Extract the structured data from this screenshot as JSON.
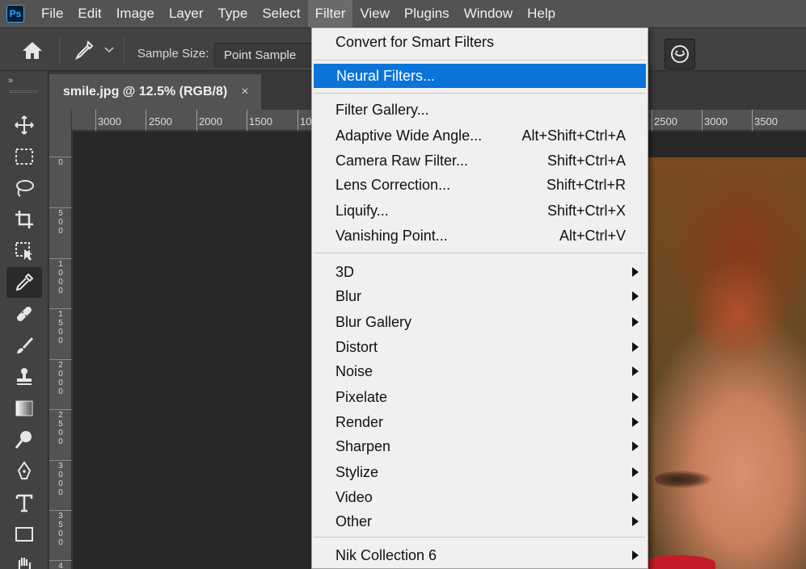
{
  "app": {
    "logo": "Ps"
  },
  "menubar": {
    "items": [
      "File",
      "Edit",
      "Image",
      "Layer",
      "Type",
      "Select",
      "Filter",
      "View",
      "Plugins",
      "Window",
      "Help"
    ],
    "active": "Filter"
  },
  "options": {
    "sample_size_label": "Sample Size:",
    "sample_size_value": "Point Sample"
  },
  "toolpanel": {
    "collapse": "››",
    "tools": [
      "move-icon",
      "marquee-icon",
      "lasso-icon",
      "crop-icon",
      "object-select-icon",
      "eyedropper-icon",
      "healing-icon",
      "brush-icon",
      "stamp-icon",
      "gradient-icon",
      "dodge-icon",
      "pen-icon",
      "type-icon",
      "rectangle-icon",
      "hand-icon"
    ],
    "active": "eyedropper-icon"
  },
  "document": {
    "tab_title": "smile.jpg @ 12.5% (RGB/8)",
    "close": "×"
  },
  "ruler_top": [
    "3000",
    "2500",
    "2000",
    "1500",
    "10",
    "2500",
    "3000",
    "3500"
  ],
  "ruler_left": [
    "0",
    "500",
    "1000",
    "1500",
    "2000",
    "2500",
    "3000",
    "3500",
    "4"
  ],
  "filter_menu": {
    "group1": [
      {
        "label": "Convert for Smart Filters"
      }
    ],
    "group2": [
      {
        "label": "Neural Filters...",
        "highlighted": true
      }
    ],
    "group3": [
      {
        "label": "Filter Gallery...",
        "shortcut": ""
      },
      {
        "label": "Adaptive Wide Angle...",
        "shortcut": "Alt+Shift+Ctrl+A"
      },
      {
        "label": "Camera Raw Filter...",
        "shortcut": "Shift+Ctrl+A"
      },
      {
        "label": "Lens Correction...",
        "shortcut": "Shift+Ctrl+R"
      },
      {
        "label": "Liquify...",
        "shortcut": "Shift+Ctrl+X"
      },
      {
        "label": "Vanishing Point...",
        "shortcut": "Alt+Ctrl+V"
      }
    ],
    "group4": [
      {
        "label": "3D"
      },
      {
        "label": "Blur"
      },
      {
        "label": "Blur Gallery"
      },
      {
        "label": "Distort"
      },
      {
        "label": "Noise"
      },
      {
        "label": "Pixelate"
      },
      {
        "label": "Render"
      },
      {
        "label": "Sharpen"
      },
      {
        "label": "Stylize"
      },
      {
        "label": "Video"
      },
      {
        "label": "Other"
      }
    ],
    "group5": [
      {
        "label": "Nik Collection 6"
      }
    ]
  },
  "colors": {
    "highlight": "#0a74d8",
    "menubar_bg": "#535353",
    "lips": "#c41c2a"
  }
}
